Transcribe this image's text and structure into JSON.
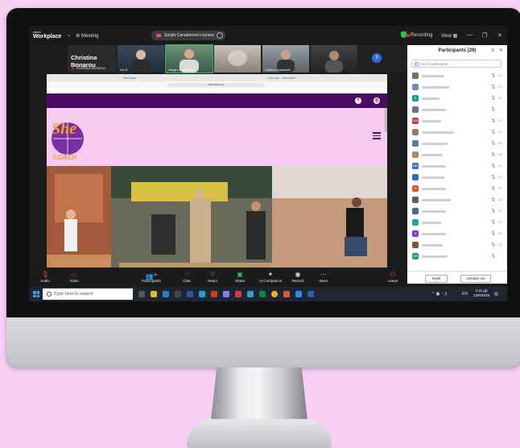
{
  "zoom": {
    "app_title_line1": "zoom",
    "app_title_line2": "Workplace",
    "meeting_label": "Meeting",
    "share_indicator": "Sergio Canaberroe's screen",
    "recording_label": "Recording",
    "view_label": "View",
    "window_controls": [
      "—",
      "❐",
      "✕"
    ],
    "gallery_count": "3",
    "speaker_name": "Christina Bonarou",
    "speaker_sub": "Christina Bonarou",
    "tiles": [
      {
        "name": "Lin.R"
      },
      {
        "name": "Sergio Canaberroe"
      },
      {
        "name": ""
      },
      {
        "name": "Cristina Cardarelli"
      },
      {
        "name": ""
      }
    ]
  },
  "browser": {
    "tabs": [
      "SheCoach",
      "Seconds – SheCoach"
    ],
    "url": "shecoach.eu",
    "site": {
      "social": [
        "f",
        "◎"
      ],
      "logo_line1": "She",
      "logo_line2": "COACH"
    }
  },
  "participants": {
    "title": "Participants (29)",
    "search_placeholder": "Find a participant",
    "invite_label": "Invite",
    "unmute_label": "Unmute me",
    "rows": [
      {
        "initial": "",
        "color": "#8a6b4d",
        "cam": true
      },
      {
        "initial": "",
        "color": "#6e8fb0",
        "cam": true
      },
      {
        "initial": "E",
        "color": "#1e9e8a",
        "cam": true
      },
      {
        "initial": "",
        "color": "#7c6a9a",
        "cam": false
      },
      {
        "initial": "AW",
        "color": "#d23b3b",
        "cam": true
      },
      {
        "initial": "",
        "color": "#9a7c62",
        "cam": true
      },
      {
        "initial": "",
        "color": "#5c7c9a",
        "cam": true
      },
      {
        "initial": "",
        "color": "#b08968",
        "cam": true
      },
      {
        "initial": "GN",
        "color": "#3b6fd2",
        "cam": true
      },
      {
        "initial": "",
        "color": "#2a6fb8",
        "cam": true
      },
      {
        "initial": "R",
        "color": "#e0572a",
        "cam": true
      },
      {
        "initial": "",
        "color": "#6a5a4a",
        "cam": true
      },
      {
        "initial": "",
        "color": "#4a6a8a",
        "cam": true
      },
      {
        "initial": "",
        "color": "#2aa0a0",
        "cam": true
      },
      {
        "initial": "K",
        "color": "#8a3bd2",
        "cam": true
      },
      {
        "initial": "",
        "color": "#7a5a3a",
        "cam": true
      },
      {
        "initial": "CR",
        "color": "#1f9e6e",
        "cam": false
      }
    ]
  },
  "toolbar": {
    "items": [
      {
        "label": "Audio",
        "glyph": "🎤"
      },
      {
        "label": "Video",
        "glyph": "📹"
      },
      {
        "label": "Participants",
        "glyph": "👥"
      },
      {
        "label": "Chat",
        "glyph": "💬"
      },
      {
        "label": "React",
        "glyph": "♡"
      },
      {
        "label": "Share",
        "glyph": "⬆"
      },
      {
        "label": "AI Companion",
        "glyph": "✦"
      },
      {
        "label": "Record",
        "glyph": "◉"
      },
      {
        "label": "More",
        "glyph": "⋯"
      }
    ],
    "participants_count": "29",
    "leave_label": "Leave"
  },
  "taskbar": {
    "search_placeholder": "Type here to search",
    "clock_time": "1:11 µµ",
    "clock_date": "12/6/2025",
    "lang": "EN"
  }
}
